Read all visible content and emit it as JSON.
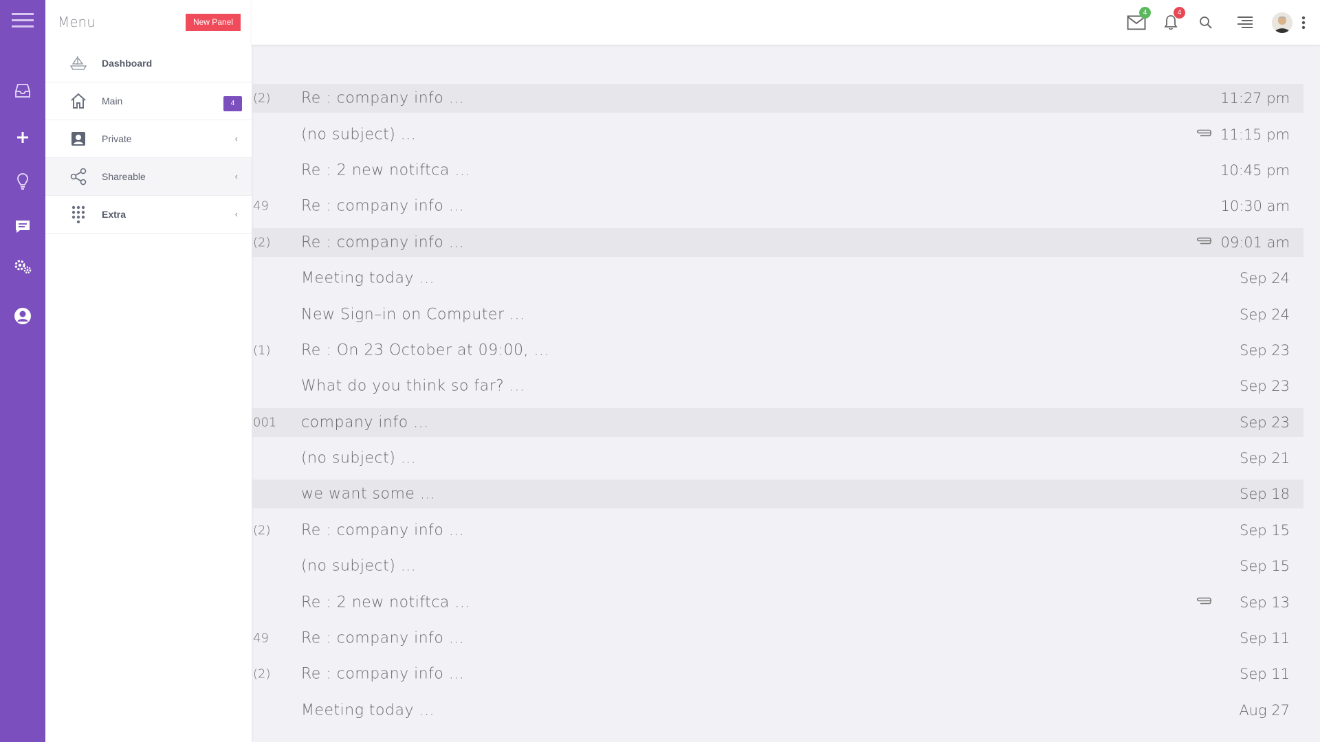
{
  "sidebar_menu": {
    "title": "Menu",
    "new_panel_label": "New Panel",
    "items": [
      {
        "label": "Dashboard",
        "icon": "ship-icon"
      },
      {
        "label": "Main",
        "icon": "home-icon",
        "badge": "4"
      },
      {
        "label": "Private",
        "icon": "contact-card-icon",
        "chevron": "‹"
      },
      {
        "label": "Shareable",
        "icon": "share-icon",
        "chevron": "‹"
      },
      {
        "label": "Extra",
        "icon": "grid-dots-icon",
        "chevron": "‹"
      }
    ]
  },
  "topbar": {
    "mail_badge": "4",
    "notification_badge": "4"
  },
  "colors": {
    "rail": "#7b4fbd",
    "new_panel": "#f04b5a",
    "mail_badge": "#5cb85c",
    "notification_badge": "#e84855"
  },
  "emails": [
    {
      "count": "(2)",
      "subject": "Re : company info ...",
      "time": "11:27 pm",
      "attachment": false,
      "shaded": true
    },
    {
      "count": "",
      "subject": "(no subject) ...",
      "time": "11:15 pm",
      "attachment": true,
      "shaded": false
    },
    {
      "count": "",
      "subject": "Re : 2 new notiftca ...",
      "time": "10:45 pm",
      "attachment": false,
      "shaded": false
    },
    {
      "count": "49",
      "subject": "Re : company info ...",
      "time": "10:30 am",
      "attachment": false,
      "shaded": false
    },
    {
      "count": "(2)",
      "subject": "Re : company info ...",
      "time": "09:01 am",
      "attachment": true,
      "shaded": true
    },
    {
      "count": "",
      "subject": "Meeting today ...",
      "time": "Sep 24",
      "attachment": false,
      "shaded": false
    },
    {
      "count": "",
      "subject": "New Sign–in on Computer ...",
      "time": "Sep 24",
      "attachment": false,
      "shaded": false
    },
    {
      "count": "(1)",
      "subject": "Re : On 23 October at 09:00, ...",
      "time": "Sep 23",
      "attachment": false,
      "shaded": false
    },
    {
      "count": "",
      "subject": "What do you think so far? ...",
      "time": "Sep 23",
      "attachment": false,
      "shaded": false
    },
    {
      "count": "001",
      "subject": "company info ...",
      "time": "Sep 23",
      "attachment": false,
      "shaded": true
    },
    {
      "count": "",
      "subject": "(no subject) ...",
      "time": "Sep 21",
      "attachment": false,
      "shaded": false
    },
    {
      "count": "",
      "subject": "we want some ...",
      "time": "Sep 18",
      "attachment": false,
      "shaded": true
    },
    {
      "count": "(2)",
      "subject": "Re : company info ...",
      "time": "Sep 15",
      "attachment": false,
      "shaded": false
    },
    {
      "count": "",
      "subject": "(no subject) ...",
      "time": "Sep 15",
      "attachment": false,
      "shaded": false
    },
    {
      "count": "",
      "subject": "Re : 2 new notiftca ...",
      "time": "Sep 13",
      "attachment": true,
      "shaded": false
    },
    {
      "count": "49",
      "subject": "Re : company info ...",
      "time": "Sep 11",
      "attachment": false,
      "shaded": false
    },
    {
      "count": "(2)",
      "subject": "Re : company info ...",
      "time": "Sep 11",
      "attachment": false,
      "shaded": false
    },
    {
      "count": "",
      "subject": "Meeting today ...",
      "time": "Aug 27",
      "attachment": false,
      "shaded": false
    }
  ]
}
